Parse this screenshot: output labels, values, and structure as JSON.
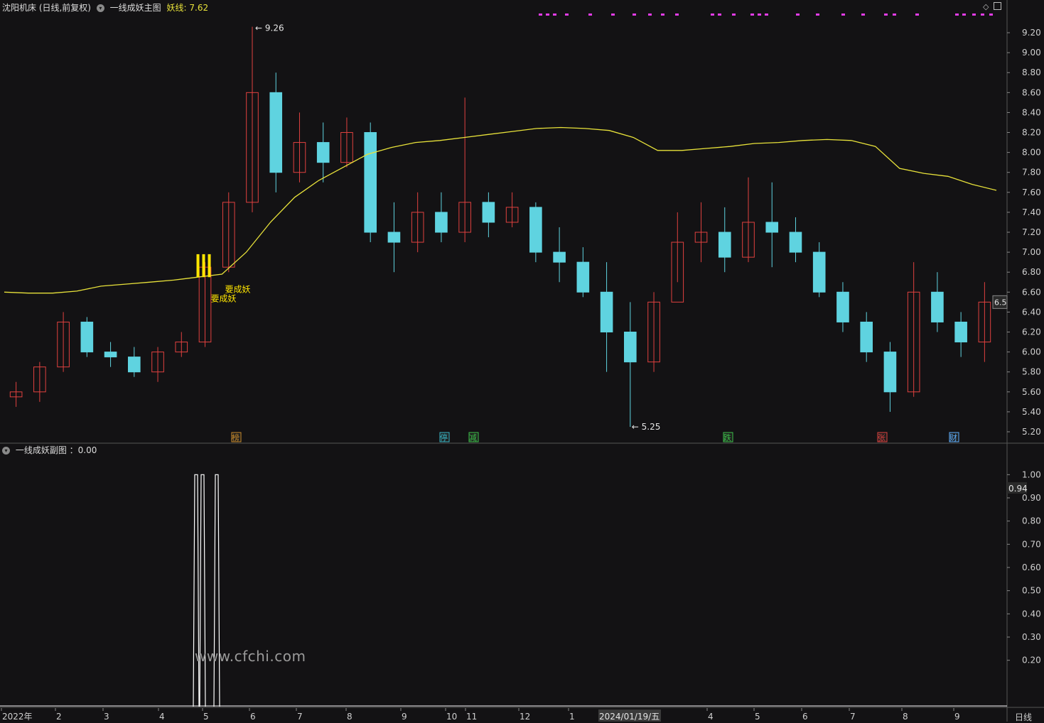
{
  "header": {
    "stock_title": "沈阳机床 (日线,前复权)",
    "indicator_name": "一线成妖主图",
    "line_label": "妖线:",
    "line_value": "7.62",
    "window_icons": [
      "diamond-icon",
      "panel-icon"
    ]
  },
  "sub_header": {
    "indicator_name": "一线成妖副图",
    "value_label": "：0.00"
  },
  "watermark": "www.cfchi.com",
  "period_button": "日线",
  "crosshair_date": "2024/01/19/五",
  "colors": {
    "background": "#131214",
    "up": "#e0413f",
    "down": "#5fd3e0",
    "ma_line": "#e8e23a",
    "signal": "#ffe600",
    "magenta": "#e23ce6",
    "grid": "#3a3a3a",
    "sub_line": "#ffffff"
  },
  "chart_data": [
    {
      "type": "candlestick",
      "title": "沈阳机床 (日线,前复权)",
      "y_ticks": [
        "9.20",
        "9.00",
        "8.80",
        "8.60",
        "8.40",
        "8.20",
        "8.00",
        "7.80",
        "7.60",
        "7.40",
        "7.20",
        "7.00",
        "6.80",
        "6.60",
        "6.40",
        "6.20",
        "6.00",
        "5.80",
        "5.60",
        "5.40",
        "5.20"
      ],
      "ylim": [
        5.15,
        9.3
      ],
      "x_ticks": [
        "2022年",
        "2",
        "3",
        "4",
        "5",
        "6",
        "7",
        "8",
        "9",
        "10",
        "11",
        "12",
        "1",
        "2024/01/19/五",
        "4",
        "5",
        "6",
        "7",
        "8",
        "9"
      ],
      "price_tag": "6.5",
      "annotations": [
        {
          "text": "9.26",
          "value": 9.26
        },
        {
          "text": "5.25",
          "value": 5.25
        },
        {
          "text": "要成妖",
          "value": 6.6
        },
        {
          "text": "要成妖",
          "value": 6.55
        }
      ],
      "events": [
        "榜",
        "停",
        "减",
        "跌",
        "张",
        "财"
      ],
      "series": [
        {
          "name": "妖线",
          "points": [
            6.6,
            6.59,
            6.59,
            6.61,
            6.66,
            6.68,
            6.7,
            6.72,
            6.75,
            6.78,
            7.0,
            7.3,
            7.55,
            7.72,
            7.85,
            7.98,
            8.05,
            8.1,
            8.12,
            8.15,
            8.18,
            8.21,
            8.24,
            8.25,
            8.24,
            8.22,
            8.15,
            8.02,
            8.02,
            8.04,
            8.06,
            8.09,
            8.1,
            8.12,
            8.13,
            8.12,
            8.06,
            7.84,
            7.79,
            7.76,
            7.68,
            7.62
          ]
        },
        {
          "name": "candles",
          "ohlc": [
            [
              5.55,
              5.7,
              5.45,
              5.6
            ],
            [
              5.6,
              5.9,
              5.5,
              5.85
            ],
            [
              5.85,
              6.4,
              5.8,
              6.3
            ],
            [
              6.3,
              6.35,
              5.95,
              6.0
            ],
            [
              6.0,
              6.1,
              5.85,
              5.95
            ],
            [
              5.95,
              6.05,
              5.75,
              5.8
            ],
            [
              5.8,
              6.05,
              5.7,
              6.0
            ],
            [
              6.0,
              6.2,
              5.95,
              6.1
            ],
            [
              6.1,
              6.9,
              6.05,
              6.85
            ],
            [
              6.85,
              7.6,
              6.8,
              7.5
            ],
            [
              7.5,
              9.26,
              7.4,
              8.6
            ],
            [
              8.6,
              8.8,
              7.6,
              7.8
            ],
            [
              7.8,
              8.4,
              7.7,
              8.1
            ],
            [
              8.1,
              8.3,
              7.7,
              7.9
            ],
            [
              7.9,
              8.35,
              7.85,
              8.2
            ],
            [
              8.2,
              8.3,
              7.1,
              7.2
            ],
            [
              7.2,
              7.5,
              6.8,
              7.1
            ],
            [
              7.1,
              7.6,
              7.0,
              7.4
            ],
            [
              7.4,
              7.6,
              7.1,
              7.2
            ],
            [
              7.2,
              8.55,
              7.1,
              7.5
            ],
            [
              7.5,
              7.6,
              7.15,
              7.3
            ],
            [
              7.3,
              7.6,
              7.25,
              7.45
            ],
            [
              7.45,
              7.5,
              6.9,
              7.0
            ],
            [
              7.0,
              7.25,
              6.7,
              6.9
            ],
            [
              6.9,
              7.05,
              6.55,
              6.6
            ],
            [
              6.6,
              6.9,
              5.8,
              6.2
            ],
            [
              6.2,
              6.5,
              5.25,
              5.9
            ],
            [
              5.9,
              6.6,
              5.8,
              6.5
            ],
            [
              6.5,
              7.4,
              6.7,
              7.1
            ],
            [
              7.1,
              7.5,
              6.9,
              7.2
            ],
            [
              7.2,
              7.45,
              6.8,
              6.95
            ],
            [
              6.95,
              7.75,
              6.9,
              7.3
            ],
            [
              7.3,
              7.7,
              6.85,
              7.2
            ],
            [
              7.2,
              7.35,
              6.9,
              7.0
            ],
            [
              7.0,
              7.1,
              6.55,
              6.6
            ],
            [
              6.6,
              6.7,
              6.2,
              6.3
            ],
            [
              6.3,
              6.4,
              5.9,
              6.0
            ],
            [
              6.0,
              6.1,
              5.4,
              5.6
            ],
            [
              5.6,
              6.9,
              5.55,
              6.6
            ],
            [
              6.6,
              6.8,
              6.2,
              6.3
            ],
            [
              6.3,
              6.4,
              5.95,
              6.1
            ],
            [
              6.1,
              6.7,
              5.9,
              6.5
            ]
          ]
        }
      ]
    },
    {
      "type": "line",
      "title": "一线成妖副图",
      "y_ticks": [
        "1.00",
        "0.90",
        "0.80",
        "0.70",
        "0.60",
        "0.50",
        "0.40",
        "0.30",
        "0.20"
      ],
      "ylim": [
        0,
        1.05
      ],
      "value_tag": "0.94",
      "series": [
        {
          "name": "一线成妖副图",
          "pulses": [
            {
              "index": 0,
              "value": 1.0
            },
            {
              "index": 1,
              "value": 1.0
            },
            {
              "index": 2,
              "value": 1.0
            }
          ]
        }
      ]
    }
  ]
}
